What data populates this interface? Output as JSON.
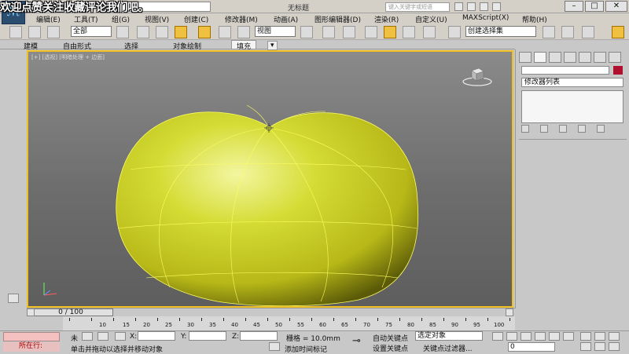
{
  "app": {
    "watermark": "欢迎点赞关注收藏评论我们吧。",
    "window_title": "无标题",
    "search_placeholder": "键入关键字或短语"
  },
  "menu": [
    {
      "label": "编辑(E)"
    },
    {
      "label": "工具(T)"
    },
    {
      "label": "组(G)"
    },
    {
      "label": "视图(V)"
    },
    {
      "label": "创建(C)"
    },
    {
      "label": "修改器(M)"
    },
    {
      "label": "动画(A)"
    },
    {
      "label": "图形编辑器(D)"
    },
    {
      "label": "渲染(R)"
    },
    {
      "label": "自定义(U)"
    },
    {
      "label": "MAXScript(X)"
    },
    {
      "label": "帮助(H)"
    }
  ],
  "toolbar": {
    "filter_select": "全部",
    "coord_select": "视图",
    "named_selection": "创建选择集"
  },
  "ribbon": {
    "tabs": [
      {
        "label": "建模"
      },
      {
        "label": "自由形式"
      },
      {
        "label": "选择"
      },
      {
        "label": "对象绘制"
      },
      {
        "label": "填充"
      }
    ]
  },
  "viewport": {
    "label": "[+] [透视] [明暗处理 + 边面]"
  },
  "command_panel": {
    "modifier_list": "修改器列表"
  },
  "timeline": {
    "frame_display": "0 / 100",
    "ticks": [
      "10",
      "15",
      "20",
      "25",
      "30",
      "35",
      "40",
      "45",
      "50",
      "55",
      "60",
      "65",
      "70",
      "75",
      "80",
      "85",
      "90",
      "95",
      "100"
    ]
  },
  "status": {
    "selection_label": "未",
    "x_label": "X:",
    "y_label": "Y:",
    "z_label": "Z:",
    "grid": "栅格 = 10.0mm",
    "auto_key": "自动关键点",
    "set_key": "设置关键点",
    "key_mode": "选定对象",
    "key_filters": "关键点过滤器...",
    "add_time_tag": "添加时间标记",
    "prompt": "单击并拖动以选择并移动对象",
    "doing": "所在行:",
    "frame_value": "0"
  },
  "colors": {
    "viewport_border": "#f0c020",
    "object": "#c8d020",
    "object_color_swatch": "#b01030"
  }
}
